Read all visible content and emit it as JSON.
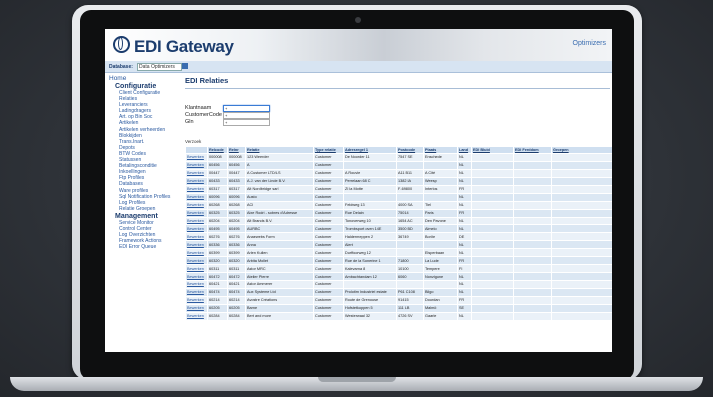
{
  "header": {
    "app_title": "EDI Gateway",
    "brand": "Optimizers"
  },
  "dbbar": {
    "label": "Database:",
    "selected": "Data Optimizers"
  },
  "sidebar": {
    "home": "Home",
    "sections": [
      {
        "title": "Configuratie",
        "items": [
          "Client Configuratie",
          "Relaties",
          "Leveranciers",
          "Ladingdragers",
          "Art. op Bin Soc",
          "Artikelen",
          "Artikelen verheerden",
          "Blokkijden",
          "Trans.Inart.",
          "Depots",
          "BTW Codes",
          "Statussen",
          "Betalingsconditie",
          "Inkoellingen",
          "Ftp Profiles",
          "Databases",
          "Ware profiles",
          "Sql Notification Profiles",
          "Log Profiles",
          "Relatie Groepen"
        ]
      },
      {
        "title": "Management",
        "items": [
          "Service Monitor",
          "Control Center",
          "Log Overzichten",
          "Framework Actions",
          "EDI Error Queue"
        ]
      }
    ]
  },
  "main": {
    "page_title": "EDI Relaties",
    "filters": [
      {
        "label": "Klantnaam",
        "value": "+"
      },
      {
        "label": "CustomerCode",
        "value": "+"
      },
      {
        "label": "Gln",
        "value": "+"
      }
    ],
    "verzoek": "Verzoek",
    "columns": [
      "",
      "Relcode",
      "Relnr",
      "Relatie",
      "Type relatie",
      "Adresregel 1",
      "Postcode",
      "Plaats",
      "Land",
      "EDI Bluid",
      "EDI Ferddom",
      "Groepen"
    ],
    "rows": [
      [
        "Bewerken",
        "000008",
        "000008",
        "123 Weerder",
        "Customer",
        "De Noorder 11",
        "7547 SE",
        "Enschede",
        "NL",
        "",
        "",
        ""
      ],
      [
        "Bewerken",
        "60456",
        "60456",
        "A",
        "Customer",
        "",
        "",
        "",
        "NL",
        "",
        "",
        ""
      ],
      [
        "Bewerken",
        "00447",
        "00447",
        "A Customer LTD/LS",
        "Customer",
        "A Rouvie",
        "A11 B11",
        "A Cité",
        "NL",
        "",
        "",
        ""
      ],
      [
        "Bewerken",
        "60433",
        "60433",
        "A.J. van der Linde B.V.",
        "Customer",
        "Perrelaan 68 C",
        "1382 IA",
        "Weesp",
        "NL",
        "",
        "",
        ""
      ],
      [
        "Bewerken",
        "60317",
        "60317",
        "Alt Nordbridge sarl",
        "Customer",
        "ZI la Motte",
        "F-69800",
        "Interlos",
        "FR",
        "",
        "",
        ""
      ],
      [
        "Bewerken",
        "60096",
        "60096",
        "Austo",
        "Customer",
        "",
        "",
        "",
        "NL",
        "",
        "",
        ""
      ],
      [
        "Bewerken",
        "60268",
        "60268",
        "ACI",
        "Customer",
        "Feldweg 13",
        "4000 SA",
        "Tiel",
        "NL",
        "",
        "",
        ""
      ],
      [
        "Bewerken",
        "60325",
        "60325",
        "Aixe Rodri - sobres d'Adresse",
        "Customer",
        "Rue Delain",
        "75014",
        "Paris",
        "FR",
        "",
        "",
        ""
      ],
      [
        "Bewerken",
        "60204",
        "60204",
        "Alt Brands B.V.",
        "Customer",
        "Tonoverweg 10",
        "1654 AC",
        "Den Pavone",
        "NL",
        "",
        "",
        ""
      ],
      [
        "Bewerken",
        "60495",
        "60495",
        "AURBC",
        "Customer",
        "Trombsport oven 14E",
        "3500 BD",
        "Almelo",
        "NL",
        "",
        "",
        ""
      ],
      [
        "Bewerken",
        "60276",
        "60276",
        "Anaewebs Form",
        "Customer",
        "Haldermeppen 2",
        "36749",
        "Borðe",
        "DE",
        "",
        "",
        ""
      ],
      [
        "Bewerken",
        "60336",
        "60336",
        "Anna",
        "Customer",
        "Alert",
        "",
        "",
        "NL",
        "",
        "",
        ""
      ],
      [
        "Bewerken",
        "60399",
        "60399",
        "Arlen Kullen",
        "Customer",
        "Durffoorweg 12",
        "",
        "Elsperbaan",
        "NL",
        "",
        "",
        ""
      ],
      [
        "Bewerken",
        "60320",
        "60320",
        "Arbita Mollet",
        "Customer",
        "Rue de la Sonerine 1",
        "71800",
        "La Lude",
        "FR",
        "",
        "",
        ""
      ],
      [
        "Bewerken",
        "60311",
        "60311",
        "Astor MRC",
        "Customer",
        "Kalevarna 8",
        "10100",
        "Tempere",
        "FI",
        "",
        "",
        ""
      ],
      [
        "Bewerken",
        "60472",
        "60472",
        "Atelier Pierre",
        "Customer",
        "Ambachtandam 12",
        "6060",
        "Nonzigune",
        "NL",
        "",
        "",
        ""
      ],
      [
        "Bewerken",
        "60421",
        "60421",
        "Astor Ammerer",
        "Customer",
        "",
        "",
        "",
        "NL",
        "",
        "",
        ""
      ],
      [
        "Bewerken",
        "60474",
        "60474",
        "Aux Systeme Ltd",
        "Customer",
        "Prolotim Industriel estate",
        "P61 C108",
        "Bilgo",
        "NL",
        "",
        "",
        ""
      ],
      [
        "Bewerken",
        "60214",
        "60214",
        "Avostre Créations",
        "Customer",
        "Route de Grenouse",
        "91415",
        "Dourdan",
        "FR",
        "",
        "",
        ""
      ],
      [
        "Bewerken",
        "60205",
        "60205",
        "Barne",
        "Customer",
        "Hofstetkoppen 5",
        "111 LB",
        "Malmö",
        "SE",
        "",
        "",
        ""
      ],
      [
        "Bewerken",
        "60284",
        "60284",
        "Bert and more",
        "Customer",
        "Westerwaal 32",
        "4726 SV",
        "Gaarle",
        "NL",
        "",
        "",
        ""
      ]
    ]
  }
}
